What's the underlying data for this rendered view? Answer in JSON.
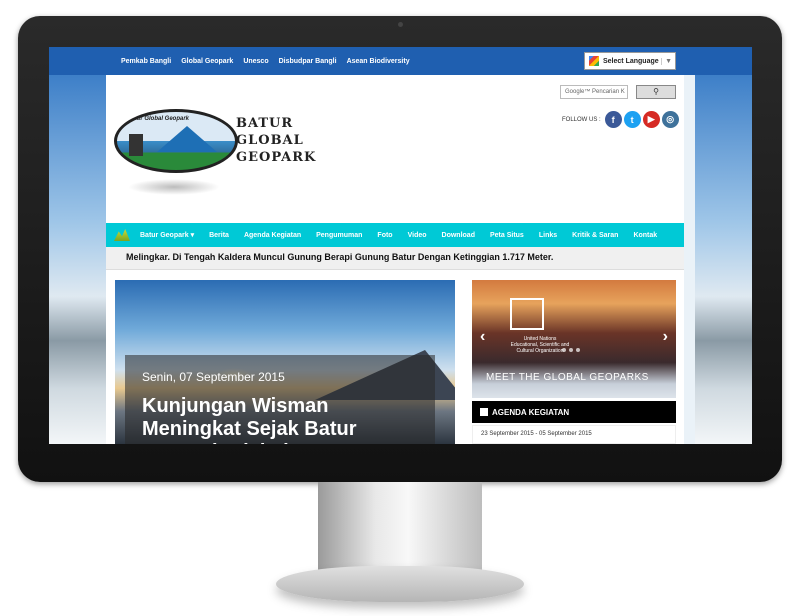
{
  "topbar": {
    "links": [
      "Pemkab Bangli",
      "Global Geopark",
      "Unesco",
      "Disbudpar Bangli",
      "Asean Biodiversity"
    ],
    "language_label": "Select Language"
  },
  "header": {
    "logo_ring_text": "Batur Global Geopark",
    "title_lines": [
      "BATUR",
      "GLOBAL",
      "GEOPARK"
    ],
    "search_placeholder": "Google™ Pencarian K",
    "follow_label": "FOLLOW US :"
  },
  "nav": {
    "items": [
      "Batur Geopark ▾",
      "Berita",
      "Agenda Kegiatan",
      "Pengumuman",
      "Foto",
      "Video",
      "Download",
      "Peta Situs",
      "Links",
      "Kritik & Saran",
      "Kontak"
    ]
  },
  "ticker": {
    "text": "Melingkar. Di Tengah Kaldera Muncul Gunung Berapi Gunung Batur Dengan Ketinggian 1.717 Meter."
  },
  "main_slide": {
    "date": "Senin, 07 September 2015",
    "headline": "Kunjungan Wisman Meningkat Sejak Batur Geopark Diakui"
  },
  "side_slide": {
    "org_text": "United Nations Educational, Scientific and Cultural Organization",
    "caption": "MEET THE GLOBAL GEOPARKS"
  },
  "agenda": {
    "title": "AGENDA KEGIATAN",
    "item": "23 September 2015 - 05 September 2015"
  },
  "colors": {
    "topbar": "#1f5fb0",
    "nav": "#00c9d6"
  }
}
